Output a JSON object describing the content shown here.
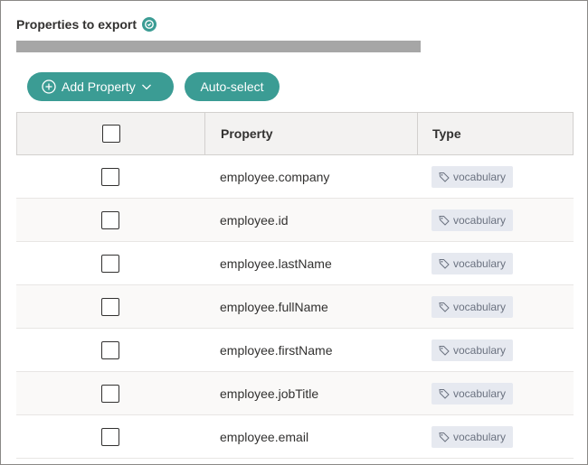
{
  "header": {
    "title": "Properties to export",
    "info_icon": "info-icon"
  },
  "progress": {
    "value": 1.0,
    "color": "#a6a6a6"
  },
  "toolbar": {
    "add_property_label": "Add Property",
    "auto_select_label": "Auto-select",
    "accent_color": "#3b9c94"
  },
  "table": {
    "columns": {
      "property": "Property",
      "type": "Type"
    },
    "rows": [
      {
        "property": "employee.company",
        "type": "vocabulary"
      },
      {
        "property": "employee.id",
        "type": "vocabulary"
      },
      {
        "property": "employee.lastName",
        "type": "vocabulary"
      },
      {
        "property": "employee.fullName",
        "type": "vocabulary"
      },
      {
        "property": "employee.firstName",
        "type": "vocabulary"
      },
      {
        "property": "employee.jobTitle",
        "type": "vocabulary"
      },
      {
        "property": "employee.email",
        "type": "vocabulary"
      }
    ]
  }
}
